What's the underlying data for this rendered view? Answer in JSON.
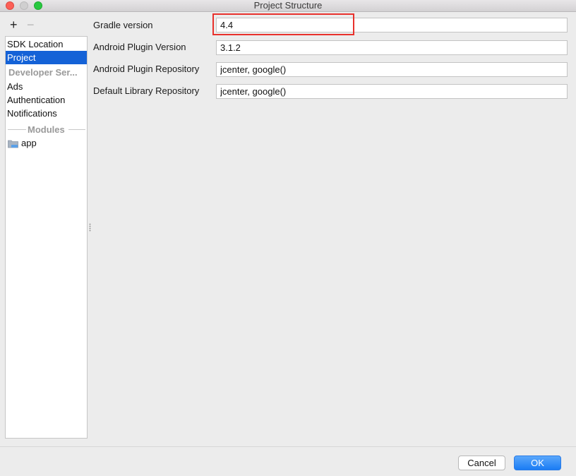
{
  "window": {
    "title": "Project Structure"
  },
  "sidebar": {
    "add_label": "+",
    "remove_label": "−",
    "items": [
      {
        "label": "SDK Location",
        "selected": false
      },
      {
        "label": "Project",
        "selected": true
      }
    ],
    "developer_services_header": "Developer Ser...",
    "service_items": [
      {
        "label": "Ads"
      },
      {
        "label": "Authentication"
      },
      {
        "label": "Notifications"
      }
    ],
    "modules_header": "Modules",
    "modules": [
      {
        "label": "app",
        "icon": "module-folder-icon"
      }
    ]
  },
  "form": {
    "fields": [
      {
        "label": "Gradle version",
        "value": "4.4"
      },
      {
        "label": "Android Plugin Version",
        "value": "3.1.2"
      },
      {
        "label": "Android Plugin Repository",
        "value": "jcenter, google()"
      },
      {
        "label": "Default Library Repository",
        "value": "jcenter, google()"
      }
    ]
  },
  "footer": {
    "cancel_label": "Cancel",
    "ok_label": "OK"
  },
  "colors": {
    "selection": "#1462d7",
    "highlight": "#e8312c",
    "ok_button": "#1a7cf4"
  }
}
